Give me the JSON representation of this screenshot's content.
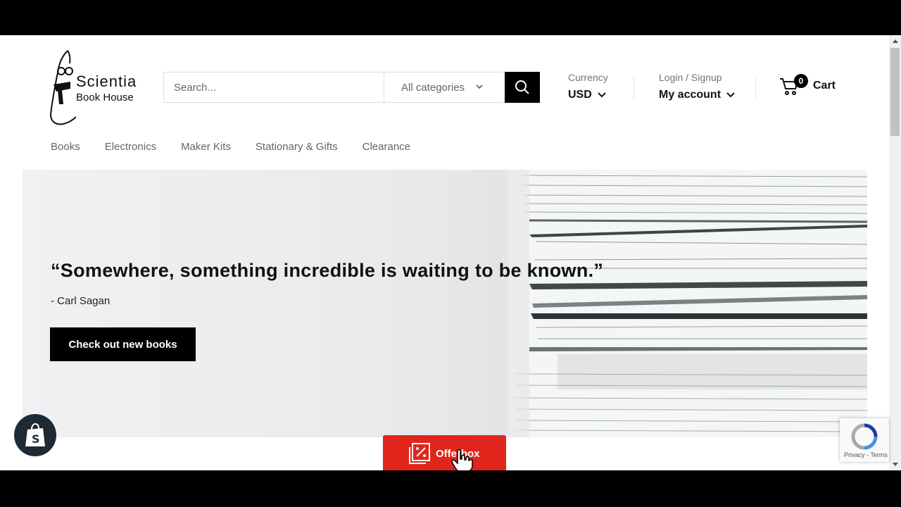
{
  "brand": {
    "name": "Scientia",
    "subtitle": "Book House"
  },
  "search": {
    "placeholder": "Search...",
    "category_label": "All categories"
  },
  "currency": {
    "label": "Currency",
    "value": "USD"
  },
  "account": {
    "label": "Login / Signup",
    "value": "My account"
  },
  "cart": {
    "count": "0",
    "label": "Cart"
  },
  "nav": {
    "items": [
      "Books",
      "Electronics",
      "Maker Kits",
      "Stationary & Gifts",
      "Clearance"
    ]
  },
  "hero": {
    "quote": "“Somewhere, something incredible is waiting to be known.”",
    "author": "- Carl Sagan",
    "cta_label": "Check out new books"
  },
  "offerbox": {
    "label": "Offerbox"
  },
  "recaptcha": {
    "terms": "Privacy - Terms"
  },
  "colors": {
    "offer_red": "#e0261c",
    "text_dark": "#111111",
    "nav_gray": "#5e6772",
    "shopify_dark": "#1f2a37"
  }
}
